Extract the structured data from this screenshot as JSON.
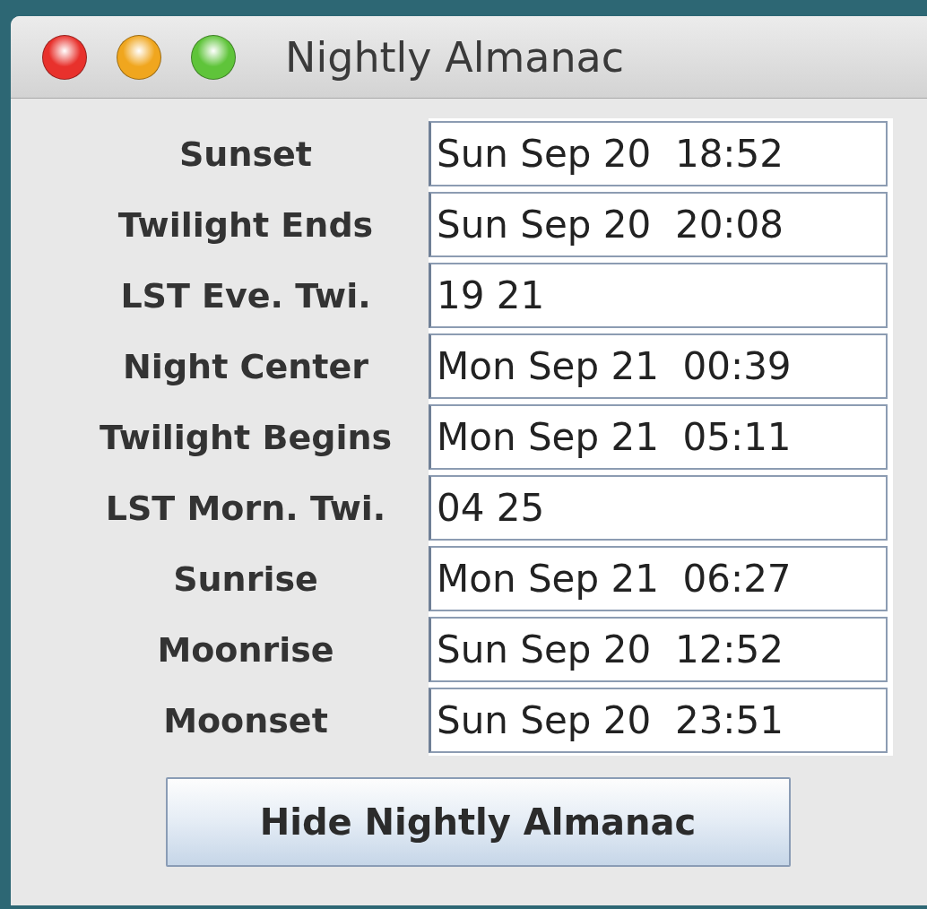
{
  "window": {
    "title": "Nightly Almanac"
  },
  "rows": [
    {
      "label": "Sunset",
      "value": "Sun Sep 20  18:52"
    },
    {
      "label": "Twilight Ends",
      "value": "Sun Sep 20  20:08"
    },
    {
      "label": "LST Eve. Twi.",
      "value": "19 21"
    },
    {
      "label": "Night Center",
      "value": "Mon Sep 21  00:39"
    },
    {
      "label": "Twilight Begins",
      "value": "Mon Sep 21  05:11"
    },
    {
      "label": "LST Morn. Twi.",
      "value": "04 25"
    },
    {
      "label": "Sunrise",
      "value": "Mon Sep 21  06:27"
    },
    {
      "label": "Moonrise",
      "value": "Sun Sep 20  12:52"
    },
    {
      "label": "Moonset",
      "value": "Sun Sep 20  23:51"
    }
  ],
  "button": "Hide Nightly Almanac"
}
